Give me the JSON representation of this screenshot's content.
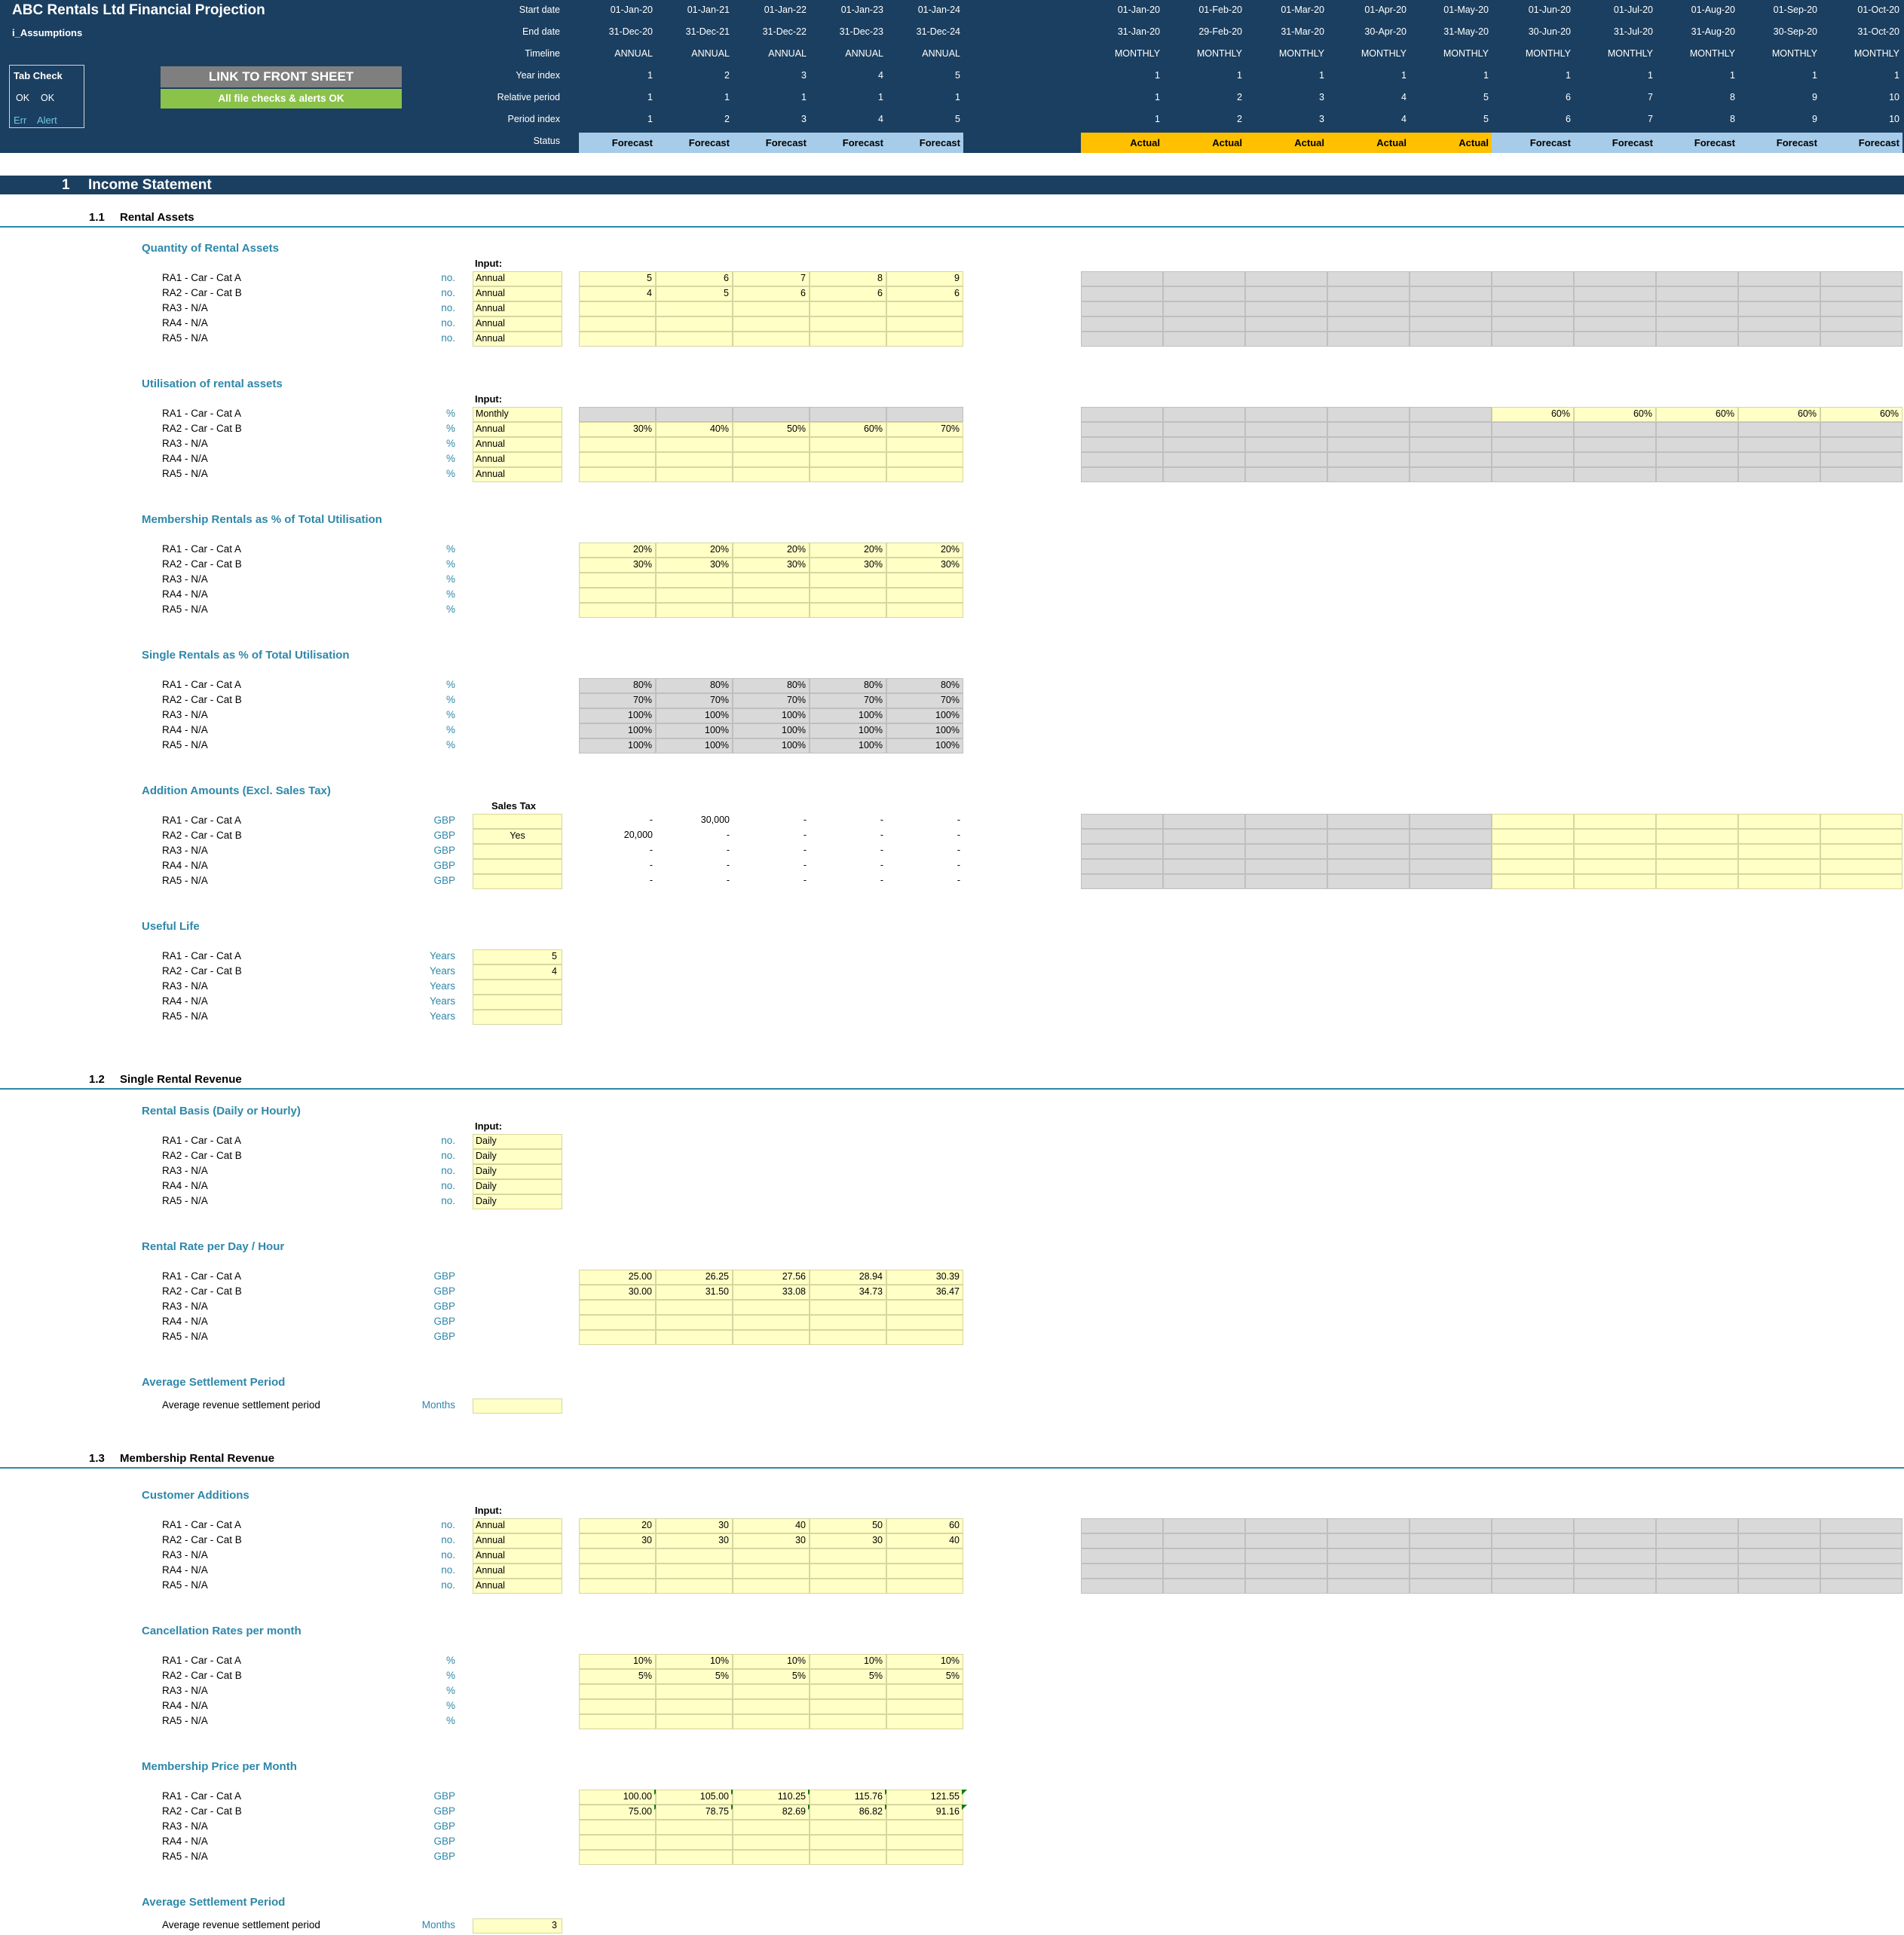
{
  "header": {
    "title": "ABC  Rentals Ltd Financial Projection",
    "sheet_name": "i_Assumptions",
    "tab_check": {
      "title": "Tab Check",
      "ok1": "OK",
      "ok2": "OK",
      "err": "Err",
      "alert": "Alert"
    },
    "link_button": "LINK TO FRONT SHEET",
    "checks_badge": "All file checks & alerts OK",
    "row_labels": [
      "Start date",
      "End date",
      "Timeline",
      "Year index",
      "Relative period",
      "Period index",
      "Status"
    ],
    "annual_cols": [
      {
        "start": "01-Jan-20",
        "end": "31-Dec-20",
        "timeline": "ANNUAL",
        "year": "1",
        "rel": "1",
        "period": "1",
        "status": "Forecast"
      },
      {
        "start": "01-Jan-21",
        "end": "31-Dec-21",
        "timeline": "ANNUAL",
        "year": "2",
        "rel": "1",
        "period": "2",
        "status": "Forecast"
      },
      {
        "start": "01-Jan-22",
        "end": "31-Dec-22",
        "timeline": "ANNUAL",
        "year": "3",
        "rel": "1",
        "period": "3",
        "status": "Forecast"
      },
      {
        "start": "01-Jan-23",
        "end": "31-Dec-23",
        "timeline": "ANNUAL",
        "year": "4",
        "rel": "1",
        "period": "4",
        "status": "Forecast"
      },
      {
        "start": "01-Jan-24",
        "end": "31-Dec-24",
        "timeline": "ANNUAL",
        "year": "5",
        "rel": "1",
        "period": "5",
        "status": "Forecast"
      }
    ],
    "monthly_cols": [
      {
        "start": "01-Jan-20",
        "end": "31-Jan-20",
        "timeline": "MONTHLY",
        "year": "1",
        "rel": "1",
        "period": "1",
        "status": "Actual"
      },
      {
        "start": "01-Feb-20",
        "end": "29-Feb-20",
        "timeline": "MONTHLY",
        "year": "1",
        "rel": "2",
        "period": "2",
        "status": "Actual"
      },
      {
        "start": "01-Mar-20",
        "end": "31-Mar-20",
        "timeline": "MONTHLY",
        "year": "1",
        "rel": "3",
        "period": "3",
        "status": "Actual"
      },
      {
        "start": "01-Apr-20",
        "end": "30-Apr-20",
        "timeline": "MONTHLY",
        "year": "1",
        "rel": "4",
        "period": "4",
        "status": "Actual"
      },
      {
        "start": "01-May-20",
        "end": "31-May-20",
        "timeline": "MONTHLY",
        "year": "1",
        "rel": "5",
        "period": "5",
        "status": "Actual"
      },
      {
        "start": "01-Jun-20",
        "end": "30-Jun-20",
        "timeline": "MONTHLY",
        "year": "1",
        "rel": "6",
        "period": "6",
        "status": "Forecast"
      },
      {
        "start": "01-Jul-20",
        "end": "31-Jul-20",
        "timeline": "MONTHLY",
        "year": "1",
        "rel": "7",
        "period": "7",
        "status": "Forecast"
      },
      {
        "start": "01-Aug-20",
        "end": "31-Aug-20",
        "timeline": "MONTHLY",
        "year": "1",
        "rel": "8",
        "period": "8",
        "status": "Forecast"
      },
      {
        "start": "01-Sep-20",
        "end": "30-Sep-20",
        "timeline": "MONTHLY",
        "year": "1",
        "rel": "9",
        "period": "9",
        "status": "Forecast"
      },
      {
        "start": "01-Oct-20",
        "end": "31-Oct-20",
        "timeline": "MONTHLY",
        "year": "1",
        "rel": "10",
        "period": "10",
        "status": "Forecast"
      }
    ]
  },
  "section": {
    "number": "1",
    "title": "Income Statement"
  },
  "subsections": [
    {
      "number": "1.1",
      "title": "Rental Assets"
    },
    {
      "number": "1.2",
      "title": "Single Rental Revenue"
    },
    {
      "number": "1.3",
      "title": "Membership Rental Revenue"
    }
  ],
  "labels": {
    "input": "Input:",
    "sales_tax": "Sales Tax"
  },
  "blocks": [
    {
      "title": "Quantity of Rental Assets",
      "input_header": "Input:",
      "rows": [
        {
          "label": "RA1 - Car - Cat A",
          "unit": "no.",
          "input": "Annual",
          "annual": [
            "5",
            "6",
            "7",
            "8",
            "9"
          ]
        },
        {
          "label": "RA2 - Car - Cat B",
          "unit": "no.",
          "input": "Annual",
          "annual": [
            "4",
            "5",
            "6",
            "6",
            "6"
          ]
        },
        {
          "label": "RA3 - N/A",
          "unit": "no.",
          "input": "Annual",
          "annual": [
            "",
            "",
            "",
            "",
            ""
          ]
        },
        {
          "label": "RA4 - N/A",
          "unit": "no.",
          "input": "Annual",
          "annual": [
            "",
            "",
            "",
            "",
            ""
          ]
        },
        {
          "label": "RA5 - N/A",
          "unit": "no.",
          "input": "Annual",
          "annual": [
            "",
            "",
            "",
            "",
            ""
          ]
        }
      ]
    },
    {
      "title": "Utilisation of rental assets",
      "input_header": "Input:",
      "rows": [
        {
          "label": "RA1 - Car - Cat A",
          "unit": "%",
          "input": "Monthly",
          "annual": [
            "",
            "",
            "",
            "",
            ""
          ],
          "monthly_fc": [
            "60%",
            "60%",
            "60%",
            "60%",
            "60%"
          ]
        },
        {
          "label": "RA2 - Car - Cat B",
          "unit": "%",
          "input": "Annual",
          "annual": [
            "30%",
            "40%",
            "50%",
            "60%",
            "70%"
          ]
        },
        {
          "label": "RA3 - N/A",
          "unit": "%",
          "input": "Annual",
          "annual": [
            "",
            "",
            "",
            "",
            ""
          ]
        },
        {
          "label": "RA4 - N/A",
          "unit": "%",
          "input": "Annual",
          "annual": [
            "",
            "",
            "",
            "",
            ""
          ]
        },
        {
          "label": "RA5 - N/A",
          "unit": "%",
          "input": "Annual",
          "annual": [
            "",
            "",
            "",
            "",
            ""
          ]
        }
      ]
    },
    {
      "title": "Membership Rentals as % of Total Utilisation",
      "rows": [
        {
          "label": "RA1 - Car - Cat A",
          "unit": "%",
          "annual": [
            "20%",
            "20%",
            "20%",
            "20%",
            "20%"
          ]
        },
        {
          "label": "RA2 - Car - Cat B",
          "unit": "%",
          "annual": [
            "30%",
            "30%",
            "30%",
            "30%",
            "30%"
          ]
        },
        {
          "label": "RA3 - N/A",
          "unit": "%",
          "annual": [
            "",
            "",
            "",
            "",
            ""
          ]
        },
        {
          "label": "RA4 - N/A",
          "unit": "%",
          "annual": [
            "",
            "",
            "",
            "",
            ""
          ]
        },
        {
          "label": "RA5 - N/A",
          "unit": "%",
          "annual": [
            "",
            "",
            "",
            "",
            ""
          ]
        }
      ]
    },
    {
      "title": "Single Rentals as % of Total Utilisation",
      "rows": [
        {
          "label": "RA1 - Car - Cat A",
          "unit": "%",
          "annual": [
            "80%",
            "80%",
            "80%",
            "80%",
            "80%"
          ]
        },
        {
          "label": "RA2 - Car - Cat B",
          "unit": "%",
          "annual": [
            "70%",
            "70%",
            "70%",
            "70%",
            "70%"
          ]
        },
        {
          "label": "RA3 - N/A",
          "unit": "%",
          "annual": [
            "100%",
            "100%",
            "100%",
            "100%",
            "100%"
          ]
        },
        {
          "label": "RA4 - N/A",
          "unit": "%",
          "annual": [
            "100%",
            "100%",
            "100%",
            "100%",
            "100%"
          ]
        },
        {
          "label": "RA5 - N/A",
          "unit": "%",
          "annual": [
            "100%",
            "100%",
            "100%",
            "100%",
            "100%"
          ]
        }
      ]
    },
    {
      "title": "Addition Amounts (Excl. Sales Tax)",
      "input_header": "Sales Tax",
      "rows": [
        {
          "label": "RA1 - Car - Cat A",
          "unit": "GBP",
          "input": "",
          "annual": [
            "-",
            "30,000",
            "-",
            "-",
            "-"
          ]
        },
        {
          "label": "RA2 - Car - Cat B",
          "unit": "GBP",
          "input": "Yes",
          "annual": [
            "20,000",
            "-",
            "-",
            "-",
            "-"
          ]
        },
        {
          "label": "RA3 - N/A",
          "unit": "GBP",
          "input": "",
          "annual": [
            "-",
            "-",
            "-",
            "-",
            "-"
          ]
        },
        {
          "label": "RA4 - N/A",
          "unit": "GBP",
          "input": "",
          "annual": [
            "-",
            "-",
            "-",
            "-",
            "-"
          ]
        },
        {
          "label": "RA5 - N/A",
          "unit": "GBP",
          "input": "",
          "annual": [
            "-",
            "-",
            "-",
            "-",
            "-"
          ]
        }
      ]
    },
    {
      "title": "Useful Life",
      "rows": [
        {
          "label": "RA1 - Car - Cat A",
          "unit": "Years",
          "input": "5"
        },
        {
          "label": "RA2 - Car - Cat B",
          "unit": "Years",
          "input": "4"
        },
        {
          "label": "RA3 - N/A",
          "unit": "Years",
          "input": ""
        },
        {
          "label": "RA4 - N/A",
          "unit": "Years",
          "input": ""
        },
        {
          "label": "RA5 - N/A",
          "unit": "Years",
          "input": ""
        }
      ]
    },
    {
      "title": "Rental Basis (Daily or Hourly)",
      "input_header": "Input:",
      "rows": [
        {
          "label": "RA1 - Car - Cat A",
          "unit": "no.",
          "input": "Daily"
        },
        {
          "label": "RA2 - Car - Cat B",
          "unit": "no.",
          "input": "Daily"
        },
        {
          "label": "RA3 - N/A",
          "unit": "no.",
          "input": "Daily"
        },
        {
          "label": "RA4 - N/A",
          "unit": "no.",
          "input": "Daily"
        },
        {
          "label": "RA5 - N/A",
          "unit": "no.",
          "input": "Daily"
        }
      ]
    },
    {
      "title": "Rental Rate per Day / Hour",
      "rows": [
        {
          "label": "RA1 - Car - Cat A",
          "unit": "GBP",
          "annual": [
            "25.00",
            "26.25",
            "27.56",
            "28.94",
            "30.39"
          ]
        },
        {
          "label": "RA2 - Car - Cat B",
          "unit": "GBP",
          "annual": [
            "30.00",
            "31.50",
            "33.08",
            "34.73",
            "36.47"
          ]
        },
        {
          "label": "RA3 - N/A",
          "unit": "GBP",
          "annual": [
            "",
            "",
            "",
            "",
            ""
          ]
        },
        {
          "label": "RA4 - N/A",
          "unit": "GBP",
          "annual": [
            "",
            "",
            "",
            "",
            ""
          ]
        },
        {
          "label": "RA5 - N/A",
          "unit": "GBP",
          "annual": [
            "",
            "",
            "",
            "",
            ""
          ]
        }
      ]
    },
    {
      "title": "Average Settlement Period",
      "rows": [
        {
          "label": "Average revenue settlement period",
          "unit": "Months",
          "input": ""
        }
      ]
    },
    {
      "title": "Customer Additions",
      "input_header": "Input:",
      "rows": [
        {
          "label": "RA1 - Car - Cat A",
          "unit": "no.",
          "input": "Annual",
          "annual": [
            "20",
            "30",
            "40",
            "50",
            "60"
          ]
        },
        {
          "label": "RA2 - Car - Cat B",
          "unit": "no.",
          "input": "Annual",
          "annual": [
            "30",
            "30",
            "30",
            "30",
            "40"
          ]
        },
        {
          "label": "RA3 - N/A",
          "unit": "no.",
          "input": "Annual",
          "annual": [
            "",
            "",
            "",
            "",
            ""
          ]
        },
        {
          "label": "RA4 - N/A",
          "unit": "no.",
          "input": "Annual",
          "annual": [
            "",
            "",
            "",
            "",
            ""
          ]
        },
        {
          "label": "RA5 - N/A",
          "unit": "no.",
          "input": "Annual",
          "annual": [
            "",
            "",
            "",
            "",
            ""
          ]
        }
      ]
    },
    {
      "title": "Cancellation Rates per month",
      "rows": [
        {
          "label": "RA1 - Car - Cat A",
          "unit": "%",
          "annual": [
            "10%",
            "10%",
            "10%",
            "10%",
            "10%"
          ]
        },
        {
          "label": "RA2 - Car - Cat B",
          "unit": "%",
          "annual": [
            "5%",
            "5%",
            "5%",
            "5%",
            "5%"
          ]
        },
        {
          "label": "RA3 - N/A",
          "unit": "%",
          "annual": [
            "",
            "",
            "",
            "",
            ""
          ]
        },
        {
          "label": "RA4 - N/A",
          "unit": "%",
          "annual": [
            "",
            "",
            "",
            "",
            ""
          ]
        },
        {
          "label": "RA5 - N/A",
          "unit": "%",
          "annual": [
            "",
            "",
            "",
            "",
            ""
          ]
        }
      ]
    },
    {
      "title": "Membership Price per Month",
      "rows": [
        {
          "label": "RA1 - Car - Cat A",
          "unit": "GBP",
          "annual": [
            "100.00",
            "105.00",
            "110.25",
            "115.76",
            "121.55"
          ]
        },
        {
          "label": "RA2 - Car - Cat B",
          "unit": "GBP",
          "annual": [
            "75.00",
            "78.75",
            "82.69",
            "86.82",
            "91.16"
          ]
        },
        {
          "label": "RA3 - N/A",
          "unit": "GBP",
          "annual": [
            "",
            "",
            "",
            "",
            ""
          ]
        },
        {
          "label": "RA4 - N/A",
          "unit": "GBP",
          "annual": [
            "",
            "",
            "",
            "",
            ""
          ]
        },
        {
          "label": "RA5 - N/A",
          "unit": "GBP",
          "annual": [
            "",
            "",
            "",
            "",
            ""
          ]
        }
      ]
    },
    {
      "title": "Average Settlement Period",
      "rows": [
        {
          "label": "Average revenue settlement period",
          "unit": "Months",
          "input": "3"
        }
      ]
    }
  ],
  "colors": {
    "header_bg": "#1b3f60",
    "accent_teal": "#2e88aa",
    "input_yellow": "#ffffc6",
    "calc_grey": "#d9d9d9",
    "forecast_blue": "#a6cce9",
    "actual_orange": "#ffc000",
    "link_button_grey": "#7f7f7f",
    "checks_green": "#8bc34a"
  }
}
